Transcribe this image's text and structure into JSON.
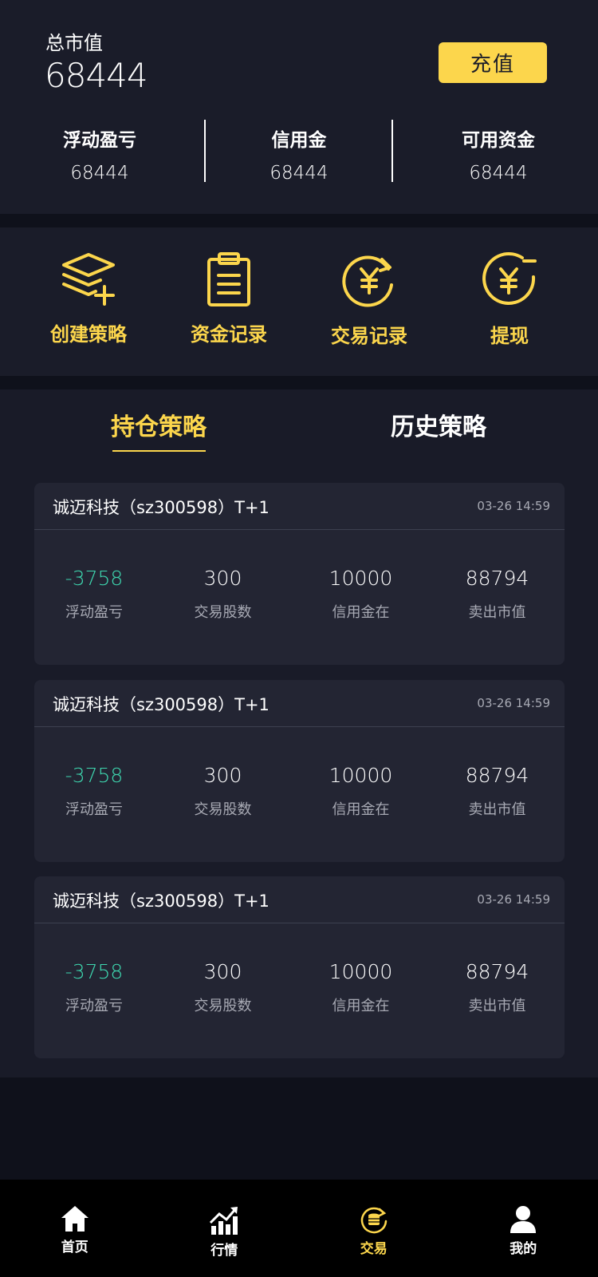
{
  "summary": {
    "total_label": "总市值",
    "total_value": "68444",
    "recharge_label": "充值",
    "stats": [
      {
        "label": "浮动盈亏",
        "value": "68444"
      },
      {
        "label": "信用金",
        "value": "68444"
      },
      {
        "label": "可用资金",
        "value": "68444"
      }
    ]
  },
  "actions": [
    {
      "label": "创建策略",
      "icon": "layers-plus-icon"
    },
    {
      "label": "资金记录",
      "icon": "clipboard-icon"
    },
    {
      "label": "交易记录",
      "icon": "yuan-cycle-icon"
    },
    {
      "label": "提现",
      "icon": "yuan-minus-icon"
    }
  ],
  "tabs": {
    "active": "持仓策略",
    "inactive": "历史策略"
  },
  "positions": [
    {
      "title": "诚迈科技（sz300598）T+1",
      "time": "03-26  14:59",
      "pnl": "-3758",
      "pnl_label": "浮动盈亏",
      "shares": "300",
      "shares_label": "交易股数",
      "credit": "10000",
      "credit_label": "信用金在",
      "market": "88794",
      "market_label": "卖出市值"
    },
    {
      "title": "诚迈科技（sz300598）T+1",
      "time": "03-26  14:59",
      "pnl": "-3758",
      "pnl_label": "浮动盈亏",
      "shares": "300",
      "shares_label": "交易股数",
      "credit": "10000",
      "credit_label": "信用金在",
      "market": "88794",
      "market_label": "卖出市值"
    },
    {
      "title": "诚迈科技（sz300598）T+1",
      "time": "03-26  14:59",
      "pnl": "-3758",
      "pnl_label": "浮动盈亏",
      "shares": "300",
      "shares_label": "交易股数",
      "credit": "10000",
      "credit_label": "信用金在",
      "market": "88794",
      "market_label": "卖出市值"
    }
  ],
  "tabbar": [
    {
      "label": "首页",
      "icon": "home-icon"
    },
    {
      "label": "行情",
      "icon": "chart-icon"
    },
    {
      "label": "交易",
      "icon": "coins-cycle-icon",
      "active": true
    },
    {
      "label": "我的",
      "icon": "user-icon"
    }
  ],
  "colors": {
    "accent": "#fcd64c",
    "negative": "#3ed8b0",
    "background": "#0f111b",
    "panel": "#1a1c29",
    "card": "#232533"
  }
}
